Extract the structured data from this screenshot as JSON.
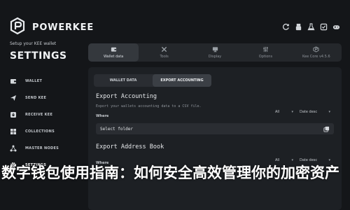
{
  "brand": {
    "name": "POWERKEE"
  },
  "header": {
    "setup_text": "Setup your KEE wallet",
    "title": "SETTINGS",
    "icons": [
      "refresh-icon",
      "usb-icon",
      "flask-icon",
      "checkbox-icon",
      "gamepad-icon"
    ]
  },
  "sidebar": {
    "items": [
      {
        "label": "WALLET",
        "icon": "wallet-icon"
      },
      {
        "label": "SEND KEE",
        "icon": "send-icon"
      },
      {
        "label": "RECEIVE KEE",
        "icon": "receive-icon"
      },
      {
        "label": "COLLECTIONS",
        "icon": "collections-icon"
      },
      {
        "label": "MASTER NODES",
        "icon": "nodes-icon"
      },
      {
        "label": "SETTINGS",
        "icon": "gear-icon"
      }
    ]
  },
  "tabs": [
    {
      "label": "Wallet data",
      "icon": "wallet-icon"
    },
    {
      "label": "Tools",
      "icon": "tools-icon"
    },
    {
      "label": "Display",
      "icon": "monitor-icon"
    },
    {
      "label": "Options",
      "icon": "options-icon"
    },
    {
      "label": "Kee Core v4.5.6",
      "icon": "core-icon"
    }
  ],
  "subtabs": [
    {
      "label": "WALLET DATA"
    },
    {
      "label": "EXPORT ACCOUNTING"
    }
  ],
  "export_accounting": {
    "title": "Export Accounting",
    "description": "Export your wallets accounting data to a CSV file.",
    "where_label": "Where",
    "filter_all": "All",
    "sort": "Date desc",
    "folder_placeholder": "Select folder"
  },
  "export_address_book": {
    "title": "Export Address Book",
    "where_label": "Where",
    "filter_all": "All",
    "sort": "Date desc"
  },
  "banner": {
    "text": "数字钱包使用指南：如何安全高效管理你的加密资产"
  }
}
